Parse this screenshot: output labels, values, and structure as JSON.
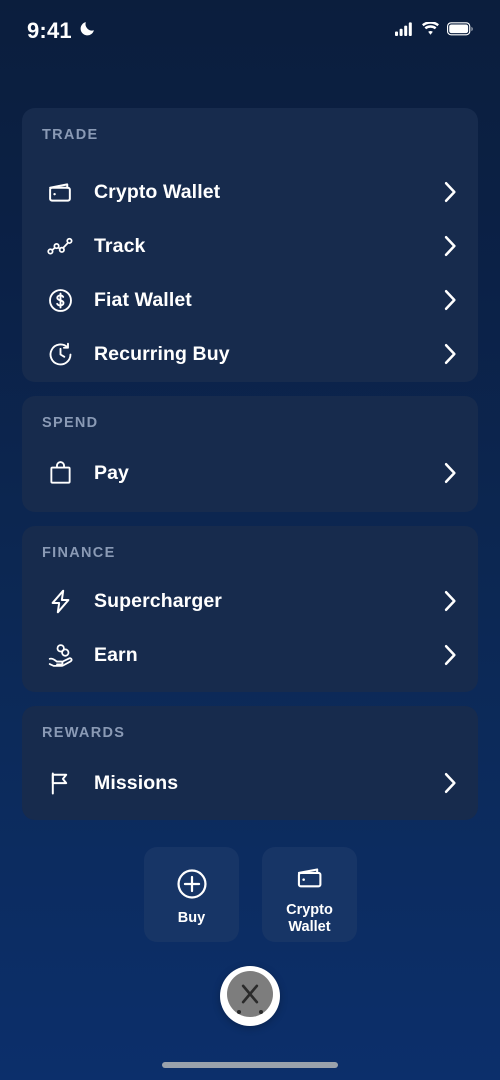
{
  "status_bar": {
    "time": "9:41",
    "dnd_icon": "crescent-moon-icon",
    "cellular_icon": "cellular-bars-icon",
    "wifi_icon": "wifi-icon",
    "battery_icon": "battery-full-icon"
  },
  "sections": [
    {
      "label": "TRADE",
      "items": [
        {
          "label": "Crypto Wallet",
          "icon": "wallet-icon"
        },
        {
          "label": "Track",
          "icon": "line-chart-dots-icon"
        },
        {
          "label": "Fiat Wallet",
          "icon": "dollar-circle-icon"
        },
        {
          "label": "Recurring Buy",
          "icon": "clock-refresh-icon"
        }
      ]
    },
    {
      "label": "SPEND",
      "items": [
        {
          "label": "Pay",
          "icon": "shopping-bag-icon"
        }
      ]
    },
    {
      "label": "FINANCE",
      "items": [
        {
          "label": "Supercharger",
          "icon": "lightning-bolt-icon"
        },
        {
          "label": "Earn",
          "icon": "hand-coins-icon"
        }
      ]
    },
    {
      "label": "REWARDS",
      "items": [
        {
          "label": "Missions",
          "icon": "flag-icon"
        }
      ]
    }
  ],
  "quick_actions": [
    {
      "label": "Buy",
      "icon": "plus-circle-icon"
    },
    {
      "label": "Crypto Wallet",
      "label_line1": "Crypto",
      "label_line2": "Wallet",
      "icon": "wallet-icon"
    }
  ],
  "floating_button": {
    "icon": "close-x-icon"
  },
  "colors": {
    "page_top": "#0b1e3d",
    "page_bottom": "#0c2f6b",
    "card": "#172b4d",
    "quick_action_card": "#173566",
    "section_label": "#8a9ab5",
    "text": "#ffffff",
    "home_indicator": "#9aa2ac"
  }
}
